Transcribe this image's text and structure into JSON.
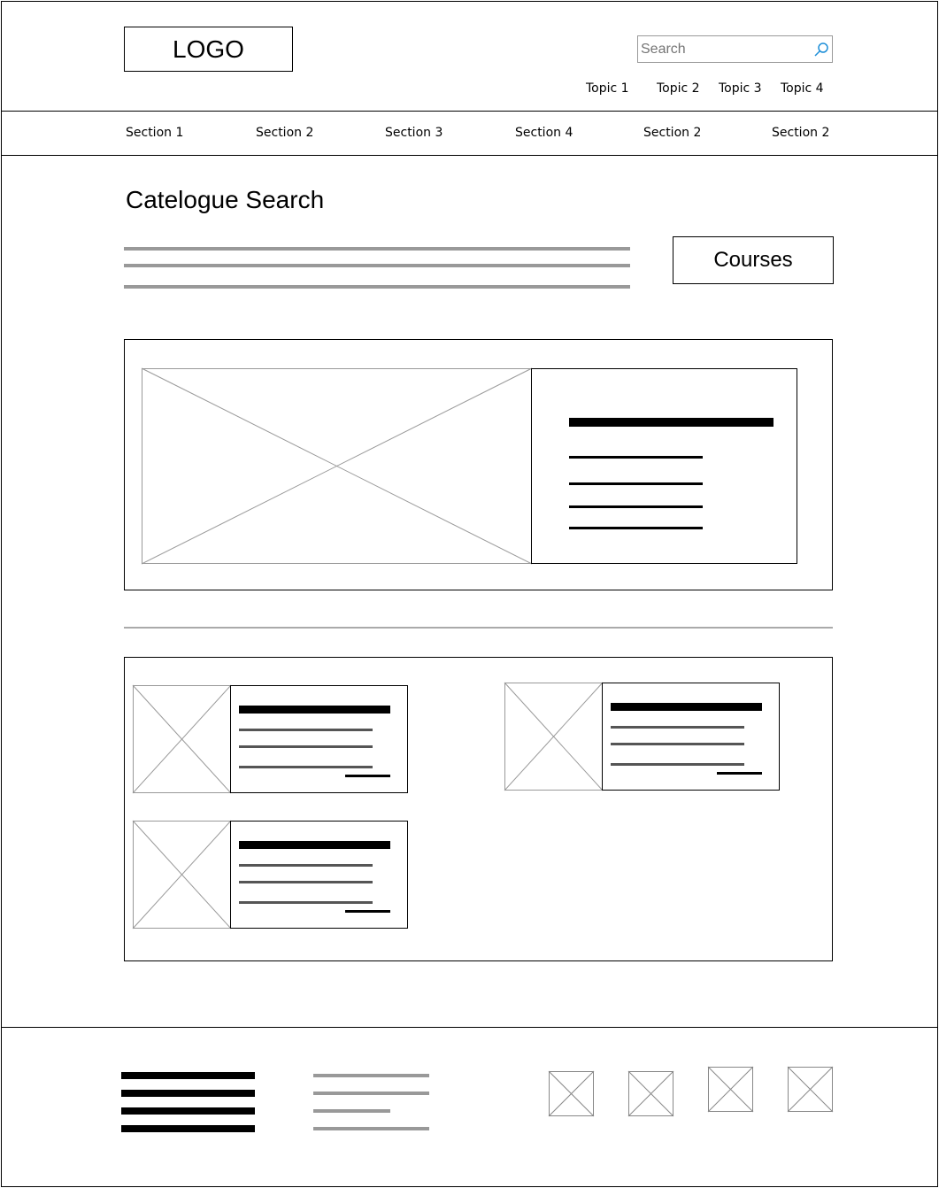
{
  "header": {
    "logo_text": "LOGO",
    "search": {
      "placeholder": "Search",
      "icon": "magnifier-icon",
      "icon_color": "#1e8fd8"
    },
    "topics": [
      "Topic 1",
      "Topic 2",
      "Topic 3",
      "Topic 4"
    ]
  },
  "nav": {
    "sections": [
      "Section 1",
      "Section 2",
      "Section 3",
      "Section 4",
      "Section 2",
      "Section 2"
    ]
  },
  "main": {
    "title": "Catelogue Search",
    "courses_button": "Courses"
  },
  "colors": {
    "ink": "#000000",
    "placeholder_gray": "#999999",
    "line_gray": "#555555",
    "divider_gray": "#aaaaaa"
  }
}
